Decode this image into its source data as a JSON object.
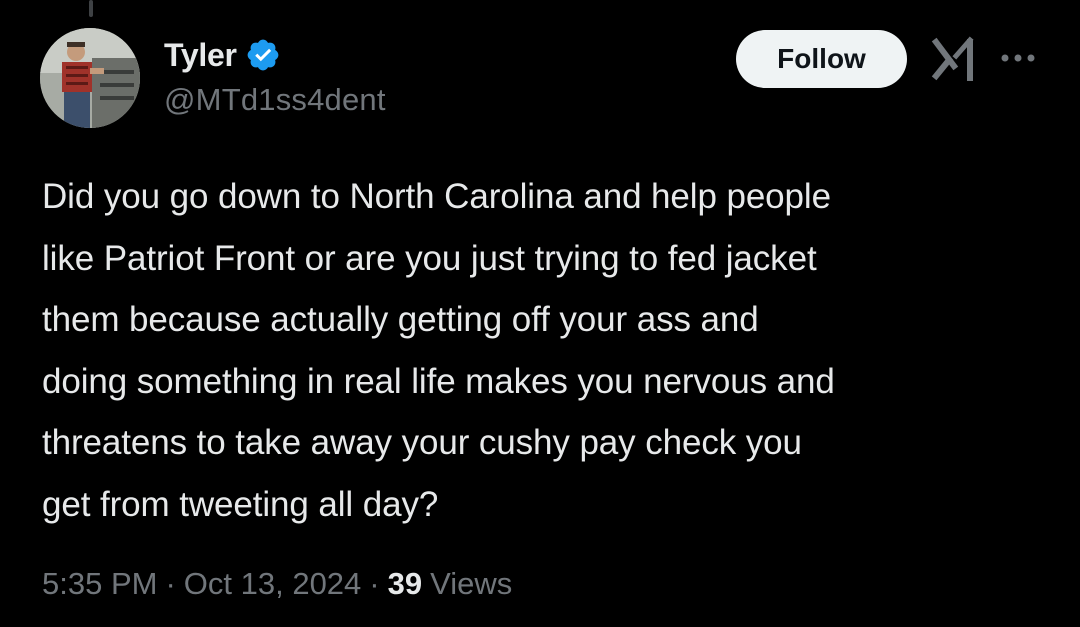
{
  "post": {
    "author": {
      "display_name": "Tyler",
      "handle": "@MTd1ss4dent",
      "verified": true,
      "avatar_icon": "profile-photo"
    },
    "actions": {
      "follow_label": "Follow",
      "grok_icon": "grok-icon",
      "more_icon": "more-horizontal-icon"
    },
    "text": "Did you go down to North Carolina and help people\nlike Patriot Front or are you just trying to fed jacket\nthem because actually getting off your ass and\ndoing something in real life makes you nervous and\nthreatens to take away your cushy pay check you\nget from tweeting all day?",
    "time": "5:35 PM",
    "date": "Oct 13, 2024",
    "views_count": "39",
    "views_label": "Views"
  },
  "colors": {
    "background": "#000000",
    "text_primary": "#e7e9ea",
    "text_secondary": "#71767b",
    "verified_blue": "#1d9bf0",
    "follow_button_bg": "#eff3f4"
  }
}
